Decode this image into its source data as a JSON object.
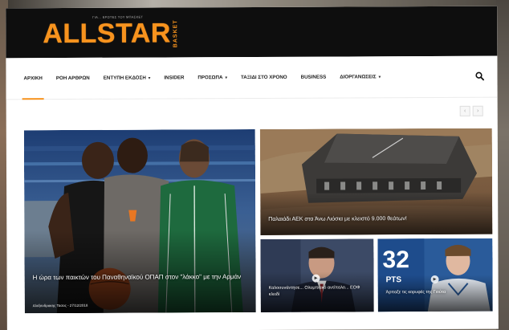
{
  "site": {
    "logo": "ALLSTAR",
    "logo_sub": "BASKET",
    "tagline": "ΓΙΑ... ΕΡΩΤΕΣ ΤΟΥ ΜΠΑΣΚΕΤ"
  },
  "nav": {
    "items": [
      {
        "label": "ΑΡΧΙΚΗ",
        "dropdown": false,
        "active": true
      },
      {
        "label": "ΡΟΗ ΑΡΘΡΩΝ",
        "dropdown": false,
        "active": false
      },
      {
        "label": "ΕΝΤΥΠΗ ΕΚΔΟΣΗ",
        "dropdown": true,
        "active": false
      },
      {
        "label": "INSIDER",
        "dropdown": false,
        "active": false
      },
      {
        "label": "ΠΡΟΣΩΠΑ",
        "dropdown": true,
        "active": false
      },
      {
        "label": "ΤΑΞΙΔΙ ΣΤΟ ΧΡΟΝΟ",
        "dropdown": false,
        "active": false
      },
      {
        "label": "BUSINESS",
        "dropdown": false,
        "active": false
      },
      {
        "label": "ΔΙΟΡΓΑΝΩΣΕΙΣ",
        "dropdown": true,
        "active": false
      }
    ],
    "caret": "▾",
    "search_icon": "search-icon"
  },
  "slider": {
    "prev": "‹",
    "next": "›"
  },
  "articles": {
    "main": {
      "title": "Η ώρα των παικτών του Παναθηναϊκού ΟΠΑΠ στον \"λάκκο\" με την Αρμάν",
      "meta": "Αλεξανδρακης Τασος - 27/12/2018"
    },
    "arena": {
      "title": "Παλαιάδι ΑΕΚ στα Άνω Λιόσια με κλειστό 9.000 θεάτων!"
    },
    "coach": {
      "title": "Καλοσυνάντησε... Ολυμπιακό αντίπαλο... ΕΟΦ κλειδί",
      "play_icon": "play-icon"
    },
    "player": {
      "title": "Άρπαξε τις κορυφές της Γιούτα",
      "jersey_number": "32",
      "jersey_text": "PTS",
      "play_icon": "play-icon"
    }
  },
  "colors": {
    "brand": "#f7931e",
    "header_bg": "#0e0e0e"
  }
}
